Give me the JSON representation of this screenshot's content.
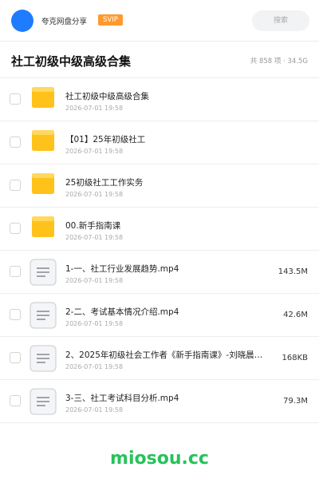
{
  "header": {
    "username": "夸克网盘分享",
    "vip_label": "SVIP",
    "search_placeholder": "搜索"
  },
  "folder": {
    "title": "社工初级中级高级合集",
    "summary": "共 858 项 · 34.5G"
  },
  "items": [
    {
      "type": "folder",
      "name": "社工初级中级高级合集",
      "date": "2026-07-01 19:58",
      "size": ""
    },
    {
      "type": "folder",
      "name": "【01】25年初级社工",
      "date": "2026-07-01 19:58",
      "size": ""
    },
    {
      "type": "folder",
      "name": "25初级社工工作实务",
      "date": "2026-07-01 19:58",
      "size": ""
    },
    {
      "type": "folder",
      "name": "00.新手指南课",
      "date": "2026-07-01 19:58",
      "size": ""
    },
    {
      "type": "file",
      "name": "1-一、社工行业发展趋势.mp4",
      "date": "2026-07-01 19:58",
      "size": "143.5M"
    },
    {
      "type": "file",
      "name": "2-二、考试基本情况介绍.mp4",
      "date": "2026-07-01 19:58",
      "size": "42.6M"
    },
    {
      "type": "file",
      "name": "2、2025年初级社会工作者《新手指南课》-刘晓晨…",
      "date": "2026-07-01 19:58",
      "size": "168KB"
    },
    {
      "type": "file",
      "name": "3-三、社工考试科目分析.mp4",
      "date": "2026-07-01 19:58",
      "size": "79.3M"
    }
  ],
  "watermark": "miosou.cc",
  "colors": {
    "avatar": "#1f7cff",
    "vip": "#ff9a2e",
    "folder": "#ffc21a",
    "watermark": "#27c25a"
  }
}
